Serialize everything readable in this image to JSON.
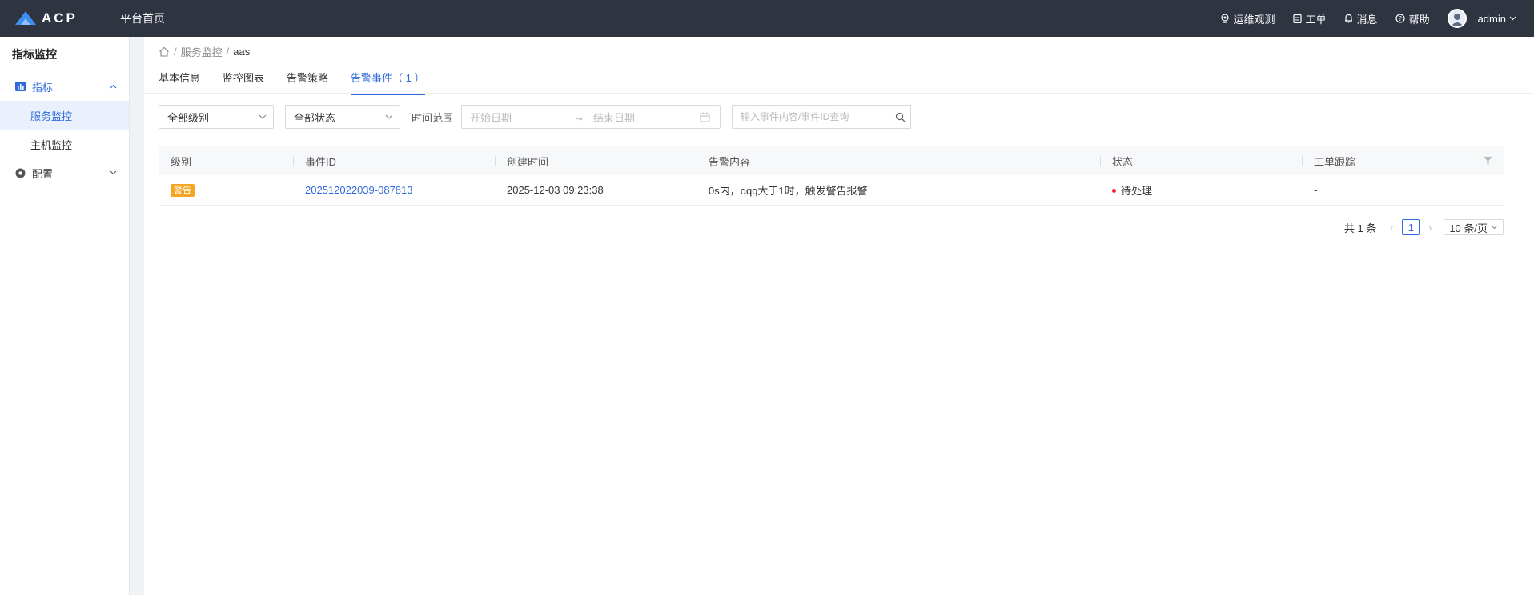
{
  "topbar": {
    "logo_text": "ACP",
    "home_label": "平台首页",
    "items": [
      {
        "label": "运维观测",
        "icon": "observe-icon"
      },
      {
        "label": "工单",
        "icon": "clipboard-icon"
      },
      {
        "label": "消息",
        "icon": "bell-icon"
      },
      {
        "label": "帮助",
        "icon": "help-icon"
      }
    ],
    "user": "admin"
  },
  "sidebar": {
    "title": "指标监控",
    "groups": [
      {
        "label": "指标",
        "icon": "chart-bar-icon",
        "expanded": true,
        "items": [
          {
            "label": "服务监控",
            "selected": true
          },
          {
            "label": "主机监控",
            "selected": false
          }
        ]
      },
      {
        "label": "配置",
        "icon": "gear-icon",
        "expanded": false
      }
    ]
  },
  "breadcrumb": {
    "items": [
      "服务监控",
      "aas"
    ]
  },
  "tabs": [
    {
      "label": "基本信息"
    },
    {
      "label": "监控图表"
    },
    {
      "label": "告警策略"
    },
    {
      "label": "告警事件（ 1 ）",
      "active": true
    }
  ],
  "filters": {
    "level": "全部级别",
    "status": "全部状态",
    "time_label": "时间范围",
    "start_placeholder": "开始日期",
    "end_placeholder": "结束日期",
    "range_separator": "→",
    "search_placeholder": "输入事件内容/事件ID查询"
  },
  "table": {
    "columns": [
      "级别",
      "事件ID",
      "创建时间",
      "告警内容",
      "状态",
      "工单跟踪"
    ],
    "rows": [
      {
        "level": "警告",
        "id": "202512022039-087813",
        "created": "2025-12-03 09:23:38",
        "content": "0s内，qqq大于1时，触发警告报警",
        "status": "待处理",
        "ticket": "-"
      }
    ]
  },
  "pagination": {
    "total": "共 1 条",
    "current": "1",
    "page_size": "10 条/页"
  },
  "colors": {
    "topbar_bg": "#2f3441",
    "accent": "#2f6bdc",
    "warning_badge": "#f5a623",
    "status_dot": "#f5222d"
  }
}
